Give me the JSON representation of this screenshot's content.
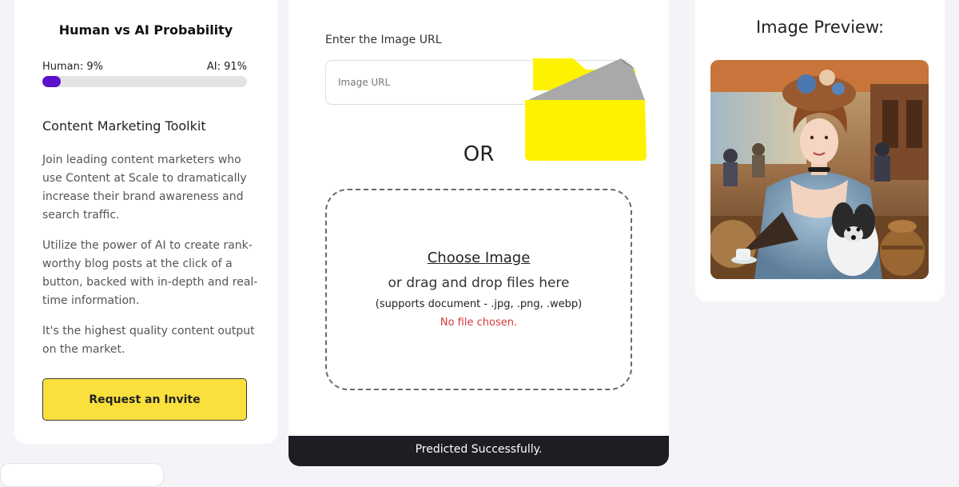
{
  "probability": {
    "title": "Human vs AI Probability",
    "human_label": "Human: 9%",
    "ai_label": "AI: 91%",
    "human_fraction": 0.09,
    "bar_color": "#5b10c9"
  },
  "toolkit": {
    "title": "Content Marketing Toolkit",
    "paragraphs": [
      "Join leading content marketers who use Content at Scale to dramatically increase their brand awareness and search traffic.",
      "Utilize the power of AI to create rank-worthy blog posts at the click of a button, backed with in-depth and real-time information.",
      "It's the highest quality content output on the market."
    ],
    "invite_button": "Request an Invite"
  },
  "upload": {
    "url_label": "Enter the Image URL",
    "url_placeholder": "Image URL",
    "url_value": "",
    "or_text": "OR",
    "choose_image": "Choose Image",
    "drag_text": "or drag and drop files here",
    "supports_text": "(supports document - .jpg, .png, .webp)",
    "no_file_text": "No file chosen.",
    "folder_icon": "folder-icon"
  },
  "status": {
    "message": "Predicted Successfully."
  },
  "preview": {
    "title": "Image Preview:",
    "image_icon": "portrait-image"
  },
  "colors": {
    "accent_yellow": "#f9e03c",
    "folder_yellow": "#fff200",
    "error_red": "#d43a3a",
    "status_bg": "#1e1d24"
  }
}
